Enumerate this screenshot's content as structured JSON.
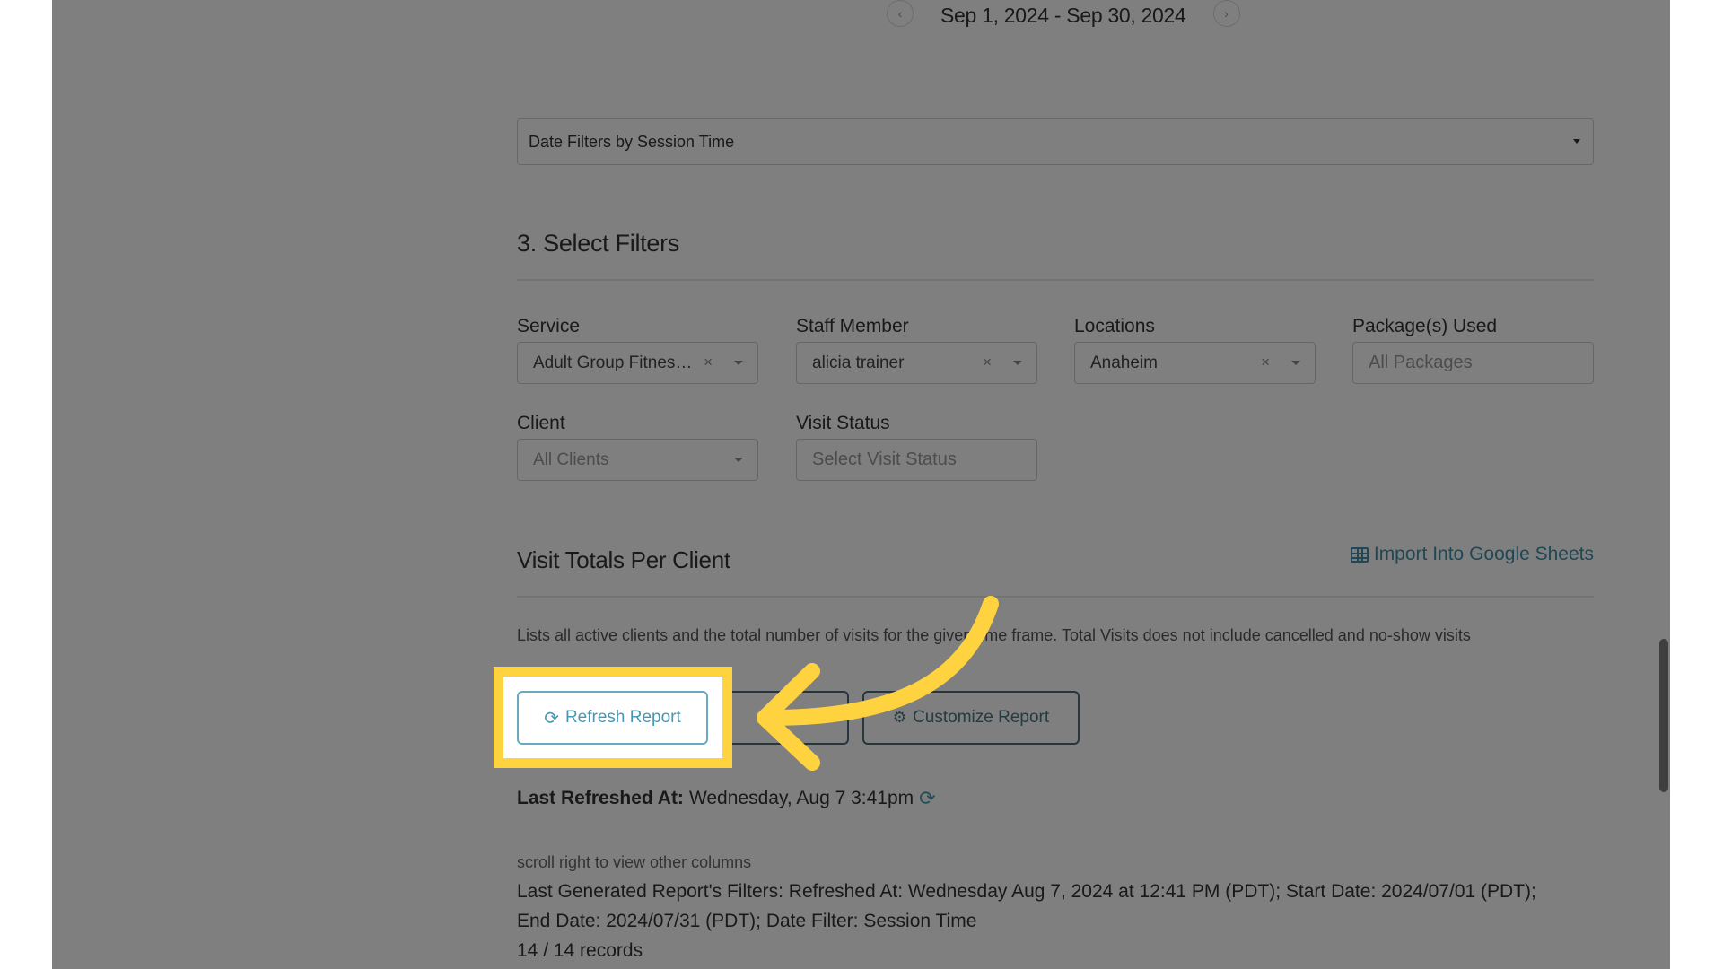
{
  "date_nav": {
    "prev_icon": "chevron-left-icon",
    "next_icon": "chevron-right-icon",
    "range": "Sep 1, 2024 - Sep 30, 2024"
  },
  "date_filter_select": {
    "value": "Date Filters by Session Time"
  },
  "filters_section": {
    "title": "3. Select Filters",
    "fields": [
      {
        "label": "Service",
        "value": "Adult Group Fitnes…",
        "clearable": true,
        "dropdown": true
      },
      {
        "label": "Staff Member",
        "value": "alicia trainer",
        "clearable": true,
        "dropdown": true
      },
      {
        "label": "Locations",
        "value": "Anaheim",
        "clearable": true,
        "dropdown": true
      },
      {
        "label": "Package(s) Used",
        "placeholder": "All Packages"
      },
      {
        "label": "Client",
        "placeholder": "All Clients",
        "dropdown": true
      },
      {
        "label": "Visit Status",
        "placeholder": "Select Visit Status"
      }
    ],
    "clear_glyph": "×"
  },
  "report": {
    "title": "Visit Totals Per Client",
    "import_link": "Import Into Google Sheets",
    "import_icon": "table-grid-icon",
    "description": "Lists all active clients and the total number of visits for the given time frame. Total Visits does not include cancelled and no-show visits",
    "buttons": {
      "refresh": "Refresh Report",
      "export_icon": "download-icon",
      "customize": "Customize Report"
    },
    "last_refreshed_label": "Last Refreshed At:",
    "last_refreshed_value": "Wednesday, Aug 7 3:41pm",
    "scroll_note": "scroll right to view other columns",
    "filters_line1": "Last Generated Report's Filters: Refreshed At: Wednesday Aug 7, 2024 at 12:41 PM (PDT); Start Date: 2024/07/01 (PDT);",
    "filters_line2": "End Date: 2024/07/31 (PDT); Date Filter: Session Time",
    "records": "14 / 14 records"
  },
  "annotation": {
    "highlight_color": "#ffd23f",
    "target": "Refresh Report"
  },
  "colors": {
    "accent": "#4a96b2",
    "overlay": "rgba(0,0,0,0.5)"
  }
}
